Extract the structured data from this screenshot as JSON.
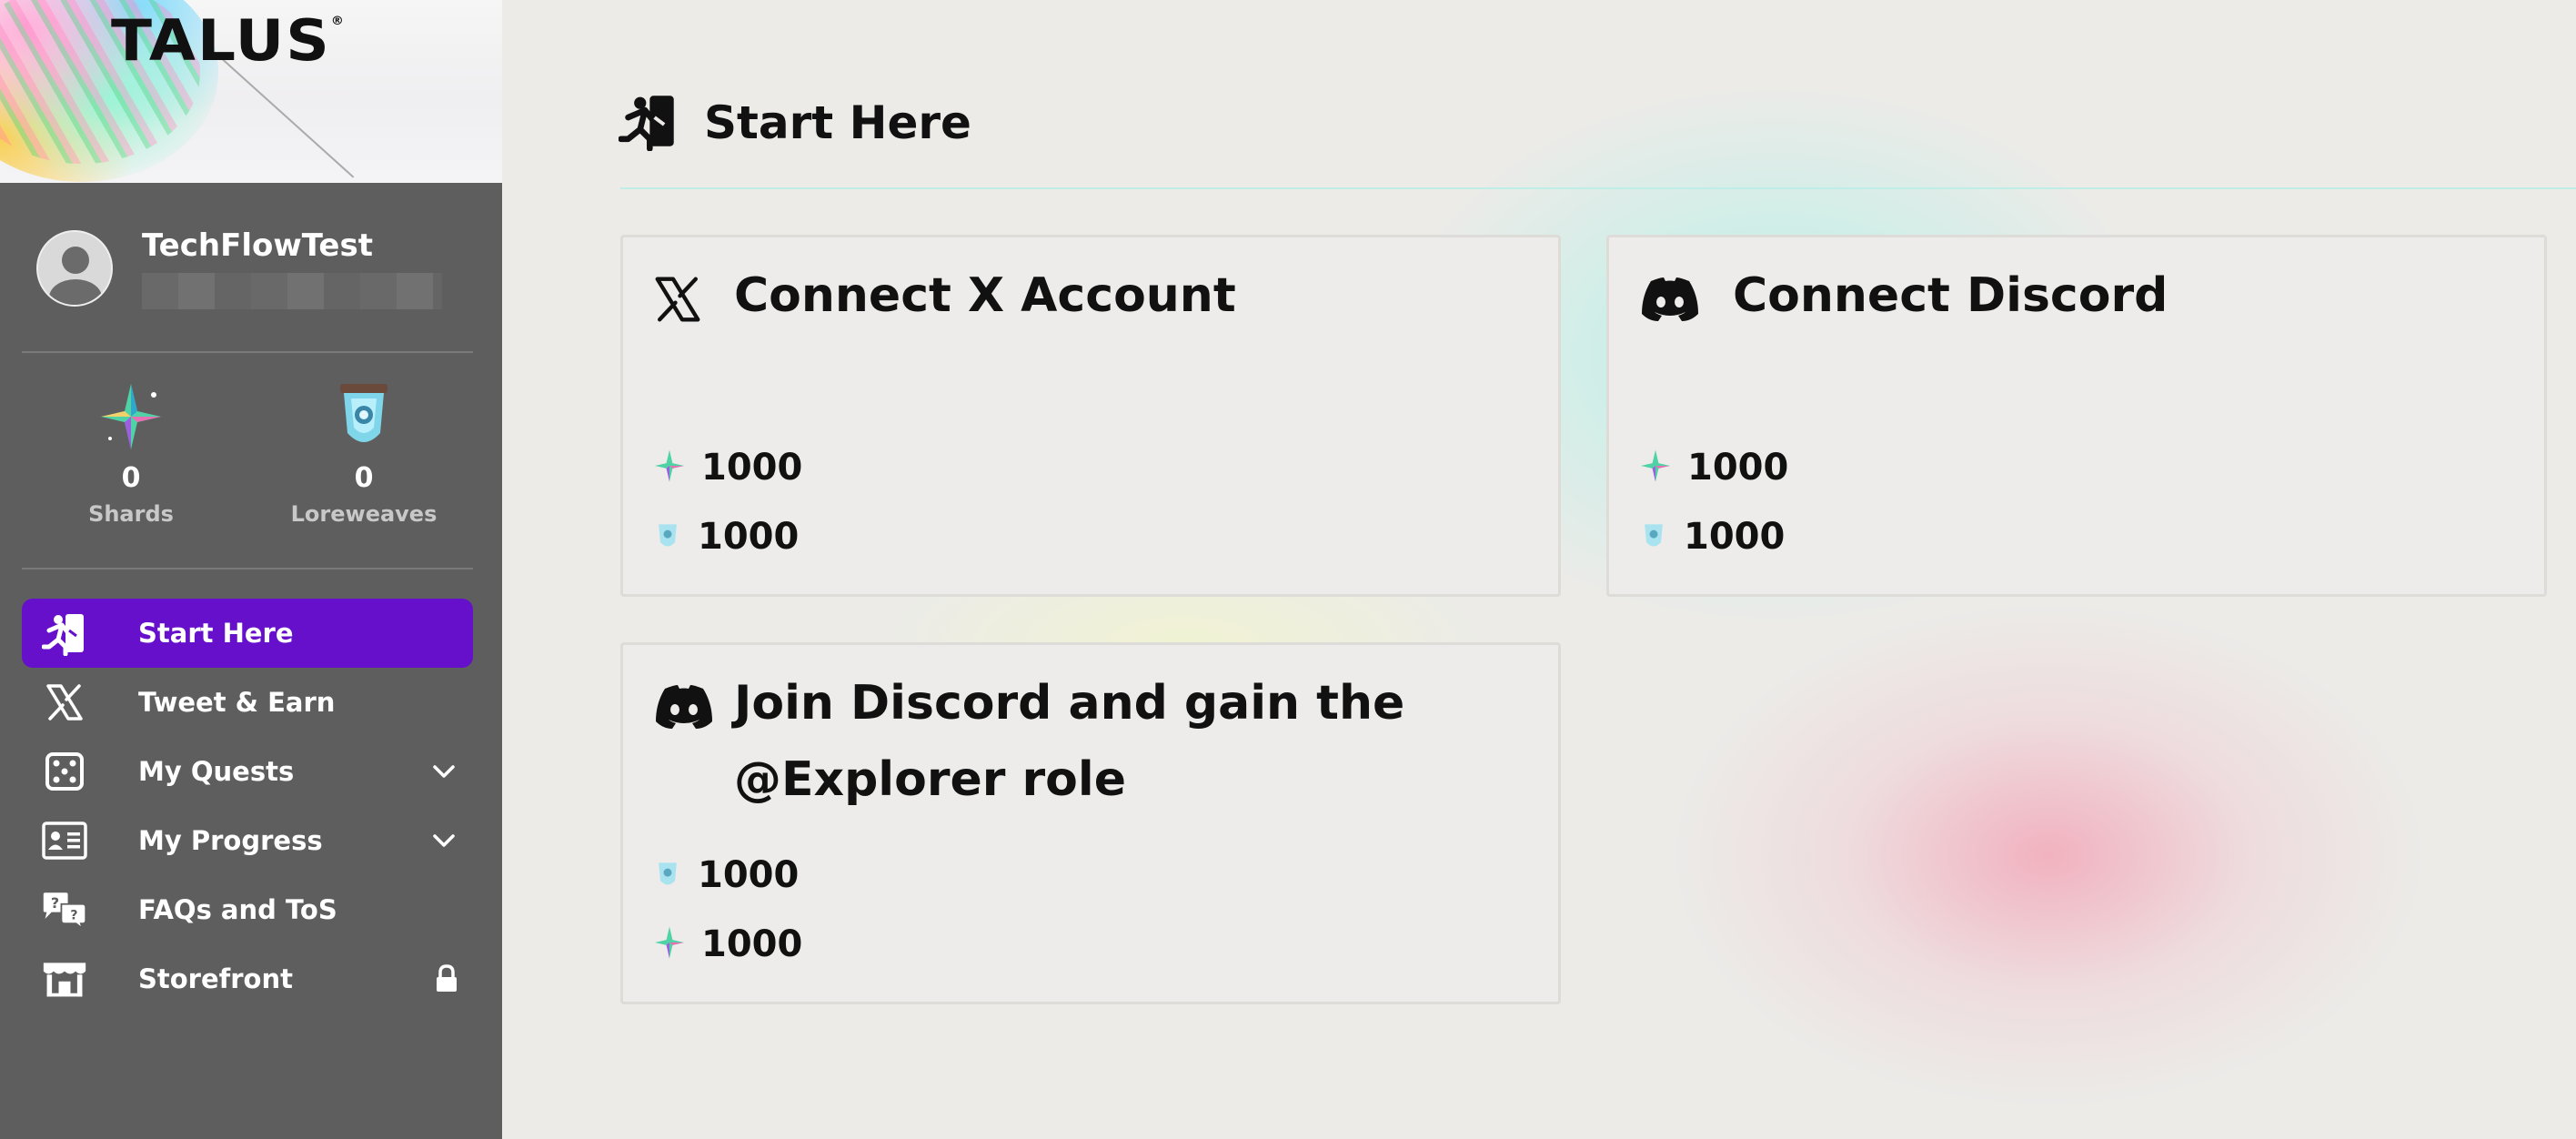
{
  "brand": {
    "logo_text": "TALUS",
    "trademark": "®"
  },
  "profile": {
    "username": "TechFlowTest"
  },
  "stats": [
    {
      "name": "shards",
      "value": "0",
      "label": "Shards"
    },
    {
      "name": "loreweaves",
      "value": "0",
      "label": "Loreweaves"
    }
  ],
  "nav": {
    "items": [
      {
        "label": "Start Here",
        "icon": "running-exit-icon",
        "active": true
      },
      {
        "label": "Tweet & Earn",
        "icon": "x-logo-icon"
      },
      {
        "label": "My Quests",
        "icon": "dice-icon",
        "expandable": true
      },
      {
        "label": "My Progress",
        "icon": "id-card-icon",
        "expandable": true
      },
      {
        "label": "FAQs and ToS",
        "icon": "question-bubbles-icon"
      },
      {
        "label": "Storefront",
        "icon": "store-icon",
        "locked": true
      }
    ]
  },
  "main": {
    "page_title": "Start Here",
    "cards": [
      {
        "title": "Connect X Account",
        "icon": "x-logo-icon",
        "rewards": [
          {
            "type": "shard",
            "value": "1000"
          },
          {
            "type": "loreweave",
            "value": "1000"
          }
        ]
      },
      {
        "title": "Connect Discord",
        "icon": "discord-icon",
        "rewards": [
          {
            "type": "shard",
            "value": "1000"
          },
          {
            "type": "loreweave",
            "value": "1000"
          }
        ]
      },
      {
        "title_line1": "Join Discord and gain the",
        "title_line2": "@Explorer role",
        "icon": "discord-icon",
        "rewards": [
          {
            "type": "loreweave",
            "value": "1000"
          },
          {
            "type": "shard",
            "value": "1000"
          }
        ]
      }
    ]
  },
  "colors": {
    "sidebar_bg": "#5e5e5e",
    "active_nav": "#6610cc",
    "page_bg": "#ecebe8",
    "card_bg": "#edecea"
  }
}
